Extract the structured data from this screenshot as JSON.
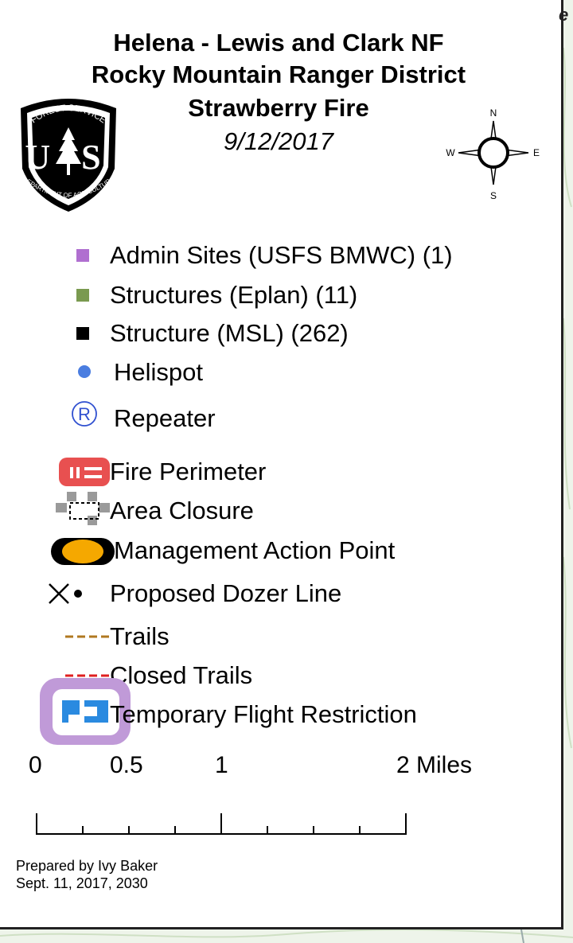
{
  "header": {
    "title_line1": "Helena - Lewis and Clark NF",
    "title_line2": "Rocky Mountain Ranger District",
    "title_line3": "Strawberry Fire",
    "date": "9/12/2017",
    "corner_fragment": "e"
  },
  "logo": {
    "top_text": "FOREST SERVICE",
    "letters": "U S",
    "bottom_text": "DEPARTMENT OF AGRICULTURE"
  },
  "compass": {
    "n": "N",
    "s": "S",
    "e": "E",
    "w": "W"
  },
  "legend": {
    "items": [
      {
        "label": "Admin Sites (USFS BMWC) (1)",
        "color": "#b06fd0",
        "icon": "square-icon"
      },
      {
        "label": "Structures (Eplan) (11)",
        "color": "#7a9a50",
        "icon": "square-icon"
      },
      {
        "label": "Structure (MSL) (262)",
        "color": "#000000",
        "icon": "square-icon"
      },
      {
        "label": "Helispot",
        "color": "#4a7de0",
        "icon": "dot-icon"
      },
      {
        "label": "Repeater",
        "color": "#3050d0",
        "icon": "circled-r-icon"
      },
      {
        "label": "Fire Perimeter",
        "color": "#e85050",
        "icon": "fire-perimeter-icon"
      },
      {
        "label": "Area Closure",
        "color": "#9a9a9a",
        "icon": "area-closure-icon"
      },
      {
        "label": "Management Action Point",
        "color": "#f5a800",
        "icon": "management-action-point-icon"
      },
      {
        "label": "Proposed Dozer Line",
        "color": "#000000",
        "icon": "dozer-line-icon"
      },
      {
        "label": "Trails",
        "color": "#b07820",
        "icon": "dashed-line-icon"
      },
      {
        "label": "Closed Trails",
        "color": "#e02020",
        "icon": "dashed-line-icon"
      },
      {
        "label": "Temporary Flight Restriction",
        "color": "#c09ad8",
        "icon": "tfr-icon"
      }
    ]
  },
  "scalebar": {
    "labels": [
      "0",
      "0.5",
      "1",
      "2 Miles"
    ]
  },
  "credits": {
    "line1": "Prepared by Ivy Baker",
    "line2": "Sept. 11, 2017, 2030"
  }
}
